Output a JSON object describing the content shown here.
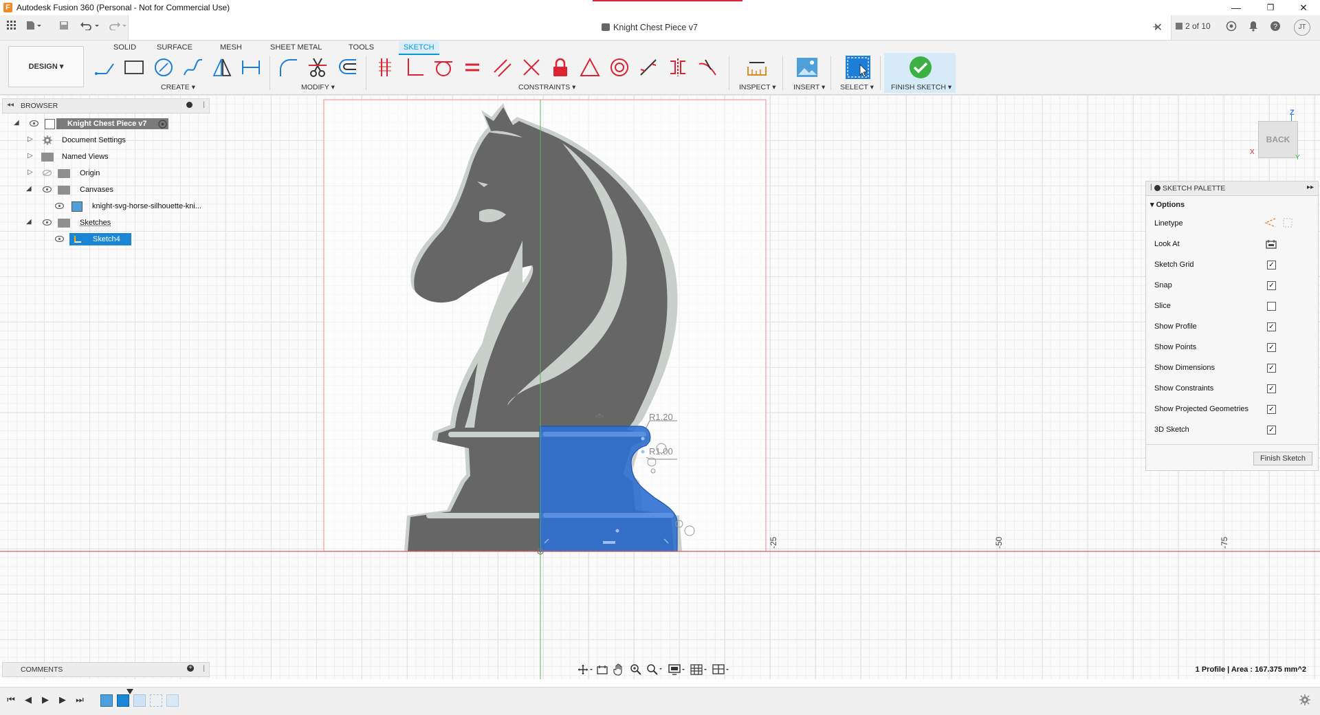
{
  "window": {
    "title": "Autodesk Fusion 360 (Personal - Not for Commercial Use)",
    "app_icon": "F",
    "minimize": "—",
    "maximize": "❐",
    "close": "✕"
  },
  "document": {
    "tab_title": "Knight Chest Piece v7",
    "page_counter": "2 of 10",
    "user_initials": "JT"
  },
  "toolbar": {
    "workspace": "DESIGN",
    "tabs": [
      "SOLID",
      "SURFACE",
      "MESH",
      "SHEET METAL",
      "TOOLS",
      "SKETCH"
    ],
    "active_tab": "SKETCH",
    "groups": {
      "create": "CREATE",
      "modify": "MODIFY",
      "constraints": "CONSTRAINTS",
      "inspect": "INSPECT",
      "insert": "INSERT",
      "select": "SELECT",
      "finish_sketch": "FINISH SKETCH"
    }
  },
  "browser": {
    "title": "BROWSER",
    "root": "Knight Chest Piece v7",
    "items": [
      {
        "label": "Document Settings"
      },
      {
        "label": "Named Views"
      },
      {
        "label": "Origin"
      },
      {
        "label": "Canvases"
      },
      {
        "label": "knight-svg-horse-silhouette-kni..."
      },
      {
        "label": "Sketches"
      },
      {
        "label": "Sketch4"
      }
    ]
  },
  "comments": {
    "title": "COMMENTS"
  },
  "sketch_palette": {
    "title": "SKETCH PALETTE",
    "section": "Options",
    "options": [
      {
        "label": "Linetype",
        "type": "icons"
      },
      {
        "label": "Look At",
        "type": "icon"
      },
      {
        "label": "Sketch Grid",
        "checked": true
      },
      {
        "label": "Snap",
        "checked": true
      },
      {
        "label": "Slice",
        "checked": false
      },
      {
        "label": "Show Profile",
        "checked": true
      },
      {
        "label": "Show Points",
        "checked": true
      },
      {
        "label": "Show Dimensions",
        "checked": true
      },
      {
        "label": "Show Constraints",
        "checked": true
      },
      {
        "label": "Show Projected Geometries",
        "checked": true
      },
      {
        "label": "3D Sketch",
        "checked": true
      }
    ],
    "finish_button": "Finish Sketch"
  },
  "viewcube": {
    "face": "BACK",
    "axis_z": "Z",
    "axis_x": "X",
    "axis_y": "Y"
  },
  "canvas": {
    "dimension_1": "R1.20",
    "dimension_2": "R1.00",
    "axis_ticks": [
      "-25",
      "-50",
      "-75"
    ]
  },
  "status": {
    "text": "1 Profile | Area : 167.375 mm^2"
  },
  "colors": {
    "accent": "#0696d7",
    "profile_fill": "#2f6fd0",
    "knight": "#666666",
    "finish_green": "#3cb043",
    "axis_red": "#e06060",
    "axis_green": "#5cb85c"
  }
}
